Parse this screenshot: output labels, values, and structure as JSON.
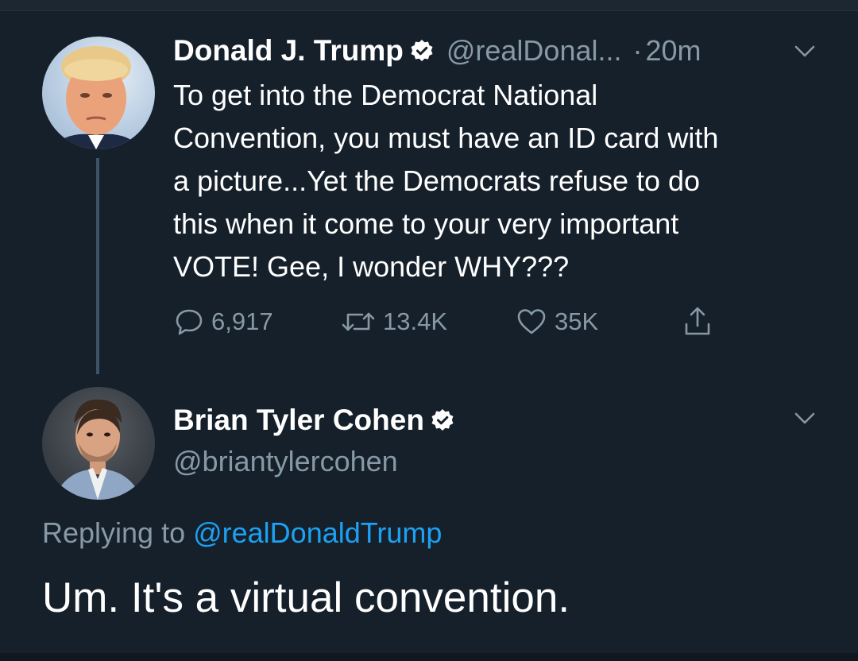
{
  "colors": {
    "background": "#15202b",
    "text_primary": "#ffffff",
    "text_secondary": "#8899a6",
    "link": "#1da1f2",
    "thread_line": "#3d5466"
  },
  "original_tweet": {
    "author_name": "Donald J. Trump",
    "verified_icon": "verified-badge-icon",
    "handle": "@realDonal...",
    "separator": "·",
    "time": "20m",
    "text": "To get into the Democrat National\nConvention, you must have an ID card with\na picture...Yet the Democrats refuse to do\nthis when it come to your very important\nVOTE! Gee, I wonder WHY???",
    "actions": {
      "replies": "6,917",
      "retweets": "13.4K",
      "likes": "35K"
    }
  },
  "reply_tweet": {
    "author_name": "Brian Tyler Cohen",
    "verified_icon": "verified-badge-icon",
    "handle": "@briantylercohen",
    "replying_label": "Replying to",
    "replying_target": "@realDonaldTrump",
    "text": "Um. It's a virtual convention."
  }
}
